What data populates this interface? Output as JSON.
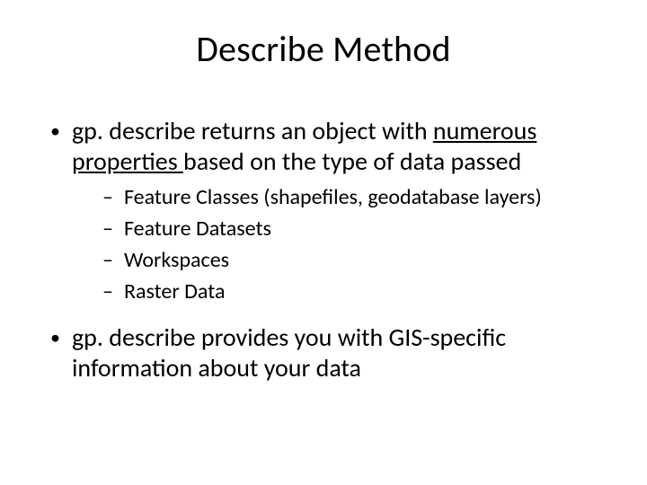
{
  "title": "Describe Method",
  "bullets": {
    "b1_pre": "gp. describe returns an object with ",
    "b1_link": "numerous properties ",
    "b1_post": "based on the type of data passed",
    "sub1": "Feature Classes (shapefiles, geodatabase layers)",
    "sub2": "Feature Datasets",
    "sub3": "Workspaces",
    "sub4": "Raster Data",
    "b2": "gp. describe provides you with GIS-specific information about your data"
  }
}
